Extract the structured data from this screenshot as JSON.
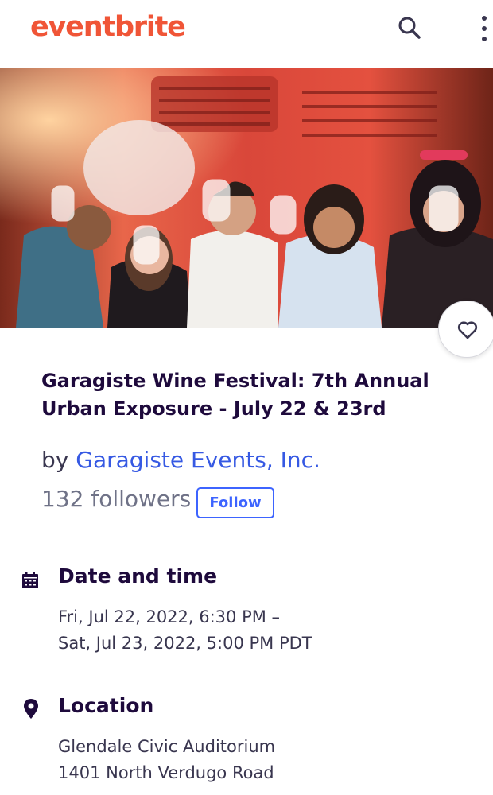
{
  "header": {
    "logo_text": "eventbrite",
    "search_icon": "search-icon",
    "more_icon": "more-vertical-icon",
    "brand_color": "#f05537"
  },
  "hero": {
    "image_description_icon": "event-photo",
    "like_icon": "heart-outline-icon"
  },
  "event": {
    "title": "Garagiste Wine Festival: 7th Annual Urban Exposure - July 22 & 23rd",
    "by_prefix": "by",
    "organizer": "Garagiste Events, Inc.",
    "followers": "132 followers",
    "follow_label": "Follow"
  },
  "date_time": {
    "icon": "calendar-icon",
    "heading": "Date and time",
    "line1": "Fri, Jul 22, 2022, 6:30 PM –",
    "line2": "Sat, Jul 23, 2022, 5:00 PM PDT"
  },
  "location": {
    "icon": "map-pin-icon",
    "heading": "Location",
    "line1": "Glendale Civic Auditorium",
    "line2": "1401 North Verdugo Road"
  },
  "colors": {
    "accent_link": "#3659e3",
    "follow_border": "#3d64ff",
    "heading": "#1e0a3c"
  }
}
